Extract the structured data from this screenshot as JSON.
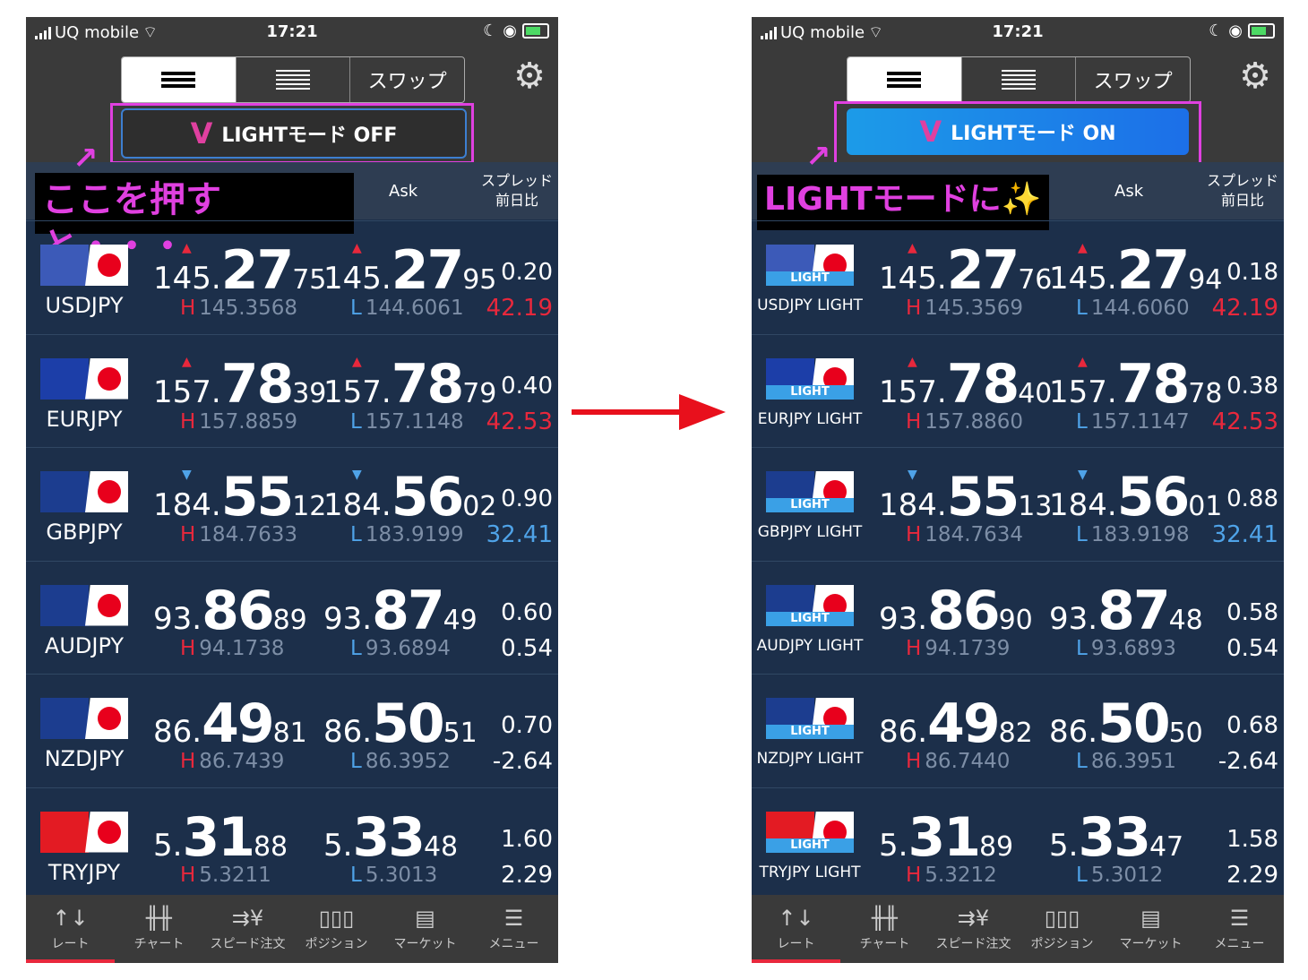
{
  "colors": {
    "accent": "#e040e0",
    "up": "#e8283c",
    "down": "#4fa3e8",
    "panel": "#1c2f4a"
  },
  "left": {
    "status": {
      "carrier": "UQ mobile",
      "time": "17:21"
    },
    "tabs": {
      "swap": "スワップ"
    },
    "light_button": "LIGHTモード OFF",
    "callout": "ここを押すと・・・",
    "header": {
      "ask": "Ask",
      "spread": "スプレッド",
      "change": "前日比"
    },
    "rows": [
      {
        "pair": "USDJPY",
        "bid_a": "145.",
        "bid_b": "27",
        "bid_c": "75",
        "ask_a": "145.",
        "ask_b": "27",
        "ask_c": "95",
        "spread": "0.20",
        "high": "145.3568",
        "low": "144.6061",
        "chg": "42.19",
        "dir": "up",
        "chgcolor": "red"
      },
      {
        "pair": "EURJPY",
        "bid_a": "157.",
        "bid_b": "78",
        "bid_c": "39",
        "ask_a": "157.",
        "ask_b": "78",
        "ask_c": "79",
        "spread": "0.40",
        "high": "157.8859",
        "low": "157.1148",
        "chg": "42.53",
        "dir": "up",
        "chgcolor": "red"
      },
      {
        "pair": "GBPJPY",
        "bid_a": "184.",
        "bid_b": "55",
        "bid_c": "12",
        "ask_a": "184.",
        "ask_b": "56",
        "ask_c": "02",
        "spread": "0.90",
        "high": "184.7633",
        "low": "183.9199",
        "chg": "32.41",
        "dir": "down",
        "chgcolor": "blue"
      },
      {
        "pair": "AUDJPY",
        "bid_a": "93.",
        "bid_b": "86",
        "bid_c": "89",
        "ask_a": "93.",
        "ask_b": "87",
        "ask_c": "49",
        "spread": "0.60",
        "high": "94.1738",
        "low": "93.6894",
        "chg": "0.54",
        "dir": "",
        "chgcolor": "white"
      },
      {
        "pair": "NZDJPY",
        "bid_a": "86.",
        "bid_b": "49",
        "bid_c": "81",
        "ask_a": "86.",
        "ask_b": "50",
        "ask_c": "51",
        "spread": "0.70",
        "high": "86.7439",
        "low": "86.3952",
        "chg": "-2.64",
        "dir": "",
        "chgcolor": "white"
      },
      {
        "pair": "TRYJPY",
        "bid_a": "5.",
        "bid_b": "31",
        "bid_c": "88",
        "ask_a": "5.",
        "ask_b": "33",
        "ask_c": "48",
        "spread": "1.60",
        "high": "5.3211",
        "low": "5.3013",
        "chg": "2.29",
        "dir": "",
        "chgcolor": "white"
      }
    ]
  },
  "right": {
    "status": {
      "carrier": "UQ mobile",
      "time": "17:21"
    },
    "tabs": {
      "swap": "スワップ"
    },
    "light_button": "LIGHTモード ON",
    "callout": "LIGHTモードに✨",
    "header": {
      "ask": "Ask",
      "spread": "スプレッド",
      "change": "前日比"
    },
    "rows": [
      {
        "pair": "USDJPY LIGHT",
        "bid_a": "145.",
        "bid_b": "27",
        "bid_c": "76",
        "ask_a": "145.",
        "ask_b": "27",
        "ask_c": "94",
        "spread": "0.18",
        "high": "145.3569",
        "low": "144.6060",
        "chg": "42.19",
        "dir": "up",
        "chgcolor": "red"
      },
      {
        "pair": "EURJPY LIGHT",
        "bid_a": "157.",
        "bid_b": "78",
        "bid_c": "40",
        "ask_a": "157.",
        "ask_b": "78",
        "ask_c": "78",
        "spread": "0.38",
        "high": "157.8860",
        "low": "157.1147",
        "chg": "42.53",
        "dir": "up",
        "chgcolor": "red"
      },
      {
        "pair": "GBPJPY LIGHT",
        "bid_a": "184.",
        "bid_b": "55",
        "bid_c": "13",
        "ask_a": "184.",
        "ask_b": "56",
        "ask_c": "01",
        "spread": "0.88",
        "high": "184.7634",
        "low": "183.9198",
        "chg": "32.41",
        "dir": "down",
        "chgcolor": "blue"
      },
      {
        "pair": "AUDJPY LIGHT",
        "bid_a": "93.",
        "bid_b": "86",
        "bid_c": "90",
        "ask_a": "93.",
        "ask_b": "87",
        "ask_c": "48",
        "spread": "0.58",
        "high": "94.1739",
        "low": "93.6893",
        "chg": "0.54",
        "dir": "",
        "chgcolor": "white"
      },
      {
        "pair": "NZDJPY LIGHT",
        "bid_a": "86.",
        "bid_b": "49",
        "bid_c": "82",
        "ask_a": "86.",
        "ask_b": "50",
        "ask_c": "50",
        "spread": "0.68",
        "high": "86.7440",
        "low": "86.3951",
        "chg": "-2.64",
        "dir": "",
        "chgcolor": "white"
      },
      {
        "pair": "TRYJPY LIGHT",
        "bid_a": "5.",
        "bid_b": "31",
        "bid_c": "89",
        "ask_a": "5.",
        "ask_b": "33",
        "ask_c": "47",
        "spread": "1.58",
        "high": "5.3212",
        "low": "5.3012",
        "chg": "2.29",
        "dir": "",
        "chgcolor": "white"
      }
    ]
  },
  "light_badge": "LIGHT",
  "high_prefix": "H",
  "low_prefix": "L",
  "triangles": {
    "up": "▲",
    "down": "▼"
  },
  "tabbar": [
    {
      "label": "レート",
      "icon": "rate-icon",
      "glyph": "↑↓"
    },
    {
      "label": "チャート",
      "icon": "chart-icon",
      "glyph": "╫╫"
    },
    {
      "label": "スピード注文",
      "icon": "speed-order-icon",
      "glyph": "⇉¥"
    },
    {
      "label": "ポジション",
      "icon": "position-icon",
      "glyph": "▯▯▯"
    },
    {
      "label": "マーケット",
      "icon": "market-icon",
      "glyph": "▤"
    },
    {
      "label": "メニュー",
      "icon": "menu-icon",
      "glyph": "☰"
    }
  ],
  "flags": [
    {
      "name": "usd",
      "color": "#3c5ab8"
    },
    {
      "name": "eur",
      "color": "#1c3ea8"
    },
    {
      "name": "gbp",
      "color": "#1c3d8f"
    },
    {
      "name": "aud",
      "color": "#1c3d8f"
    },
    {
      "name": "nzd",
      "color": "#1c3d8f"
    },
    {
      "name": "try",
      "color": "#e31b23"
    }
  ]
}
